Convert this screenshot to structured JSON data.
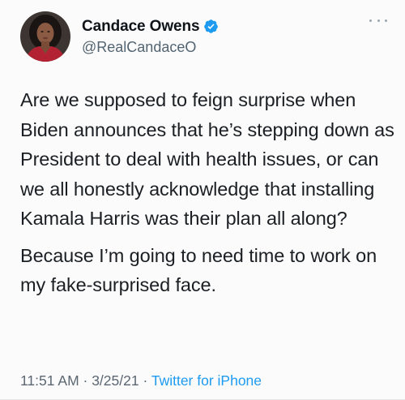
{
  "tweet": {
    "author": {
      "display_name": "Candace Owens",
      "handle": "@RealCandaceO",
      "verified": true
    },
    "text": {
      "paragraph_1": "Are we supposed to feign surprise when Biden announces that he’s stepping down as President to deal with health issues, or can we all honestly acknowledge that installing Kamala Harris was their plan all along?",
      "paragraph_2": "Because I’m going to need time to work on my fake-surprised face."
    },
    "meta": {
      "time": "11:51 AM",
      "separator_1": " · ",
      "date": "3/25/21",
      "separator_2": " · ",
      "source": "Twitter for iPhone"
    }
  },
  "icons": {
    "verified": "verified-badge-icon",
    "more": "more-options-icon"
  },
  "colors": {
    "link_blue": "#1d9bf0",
    "secondary_text": "#536471",
    "primary_text": "#0f1419"
  }
}
